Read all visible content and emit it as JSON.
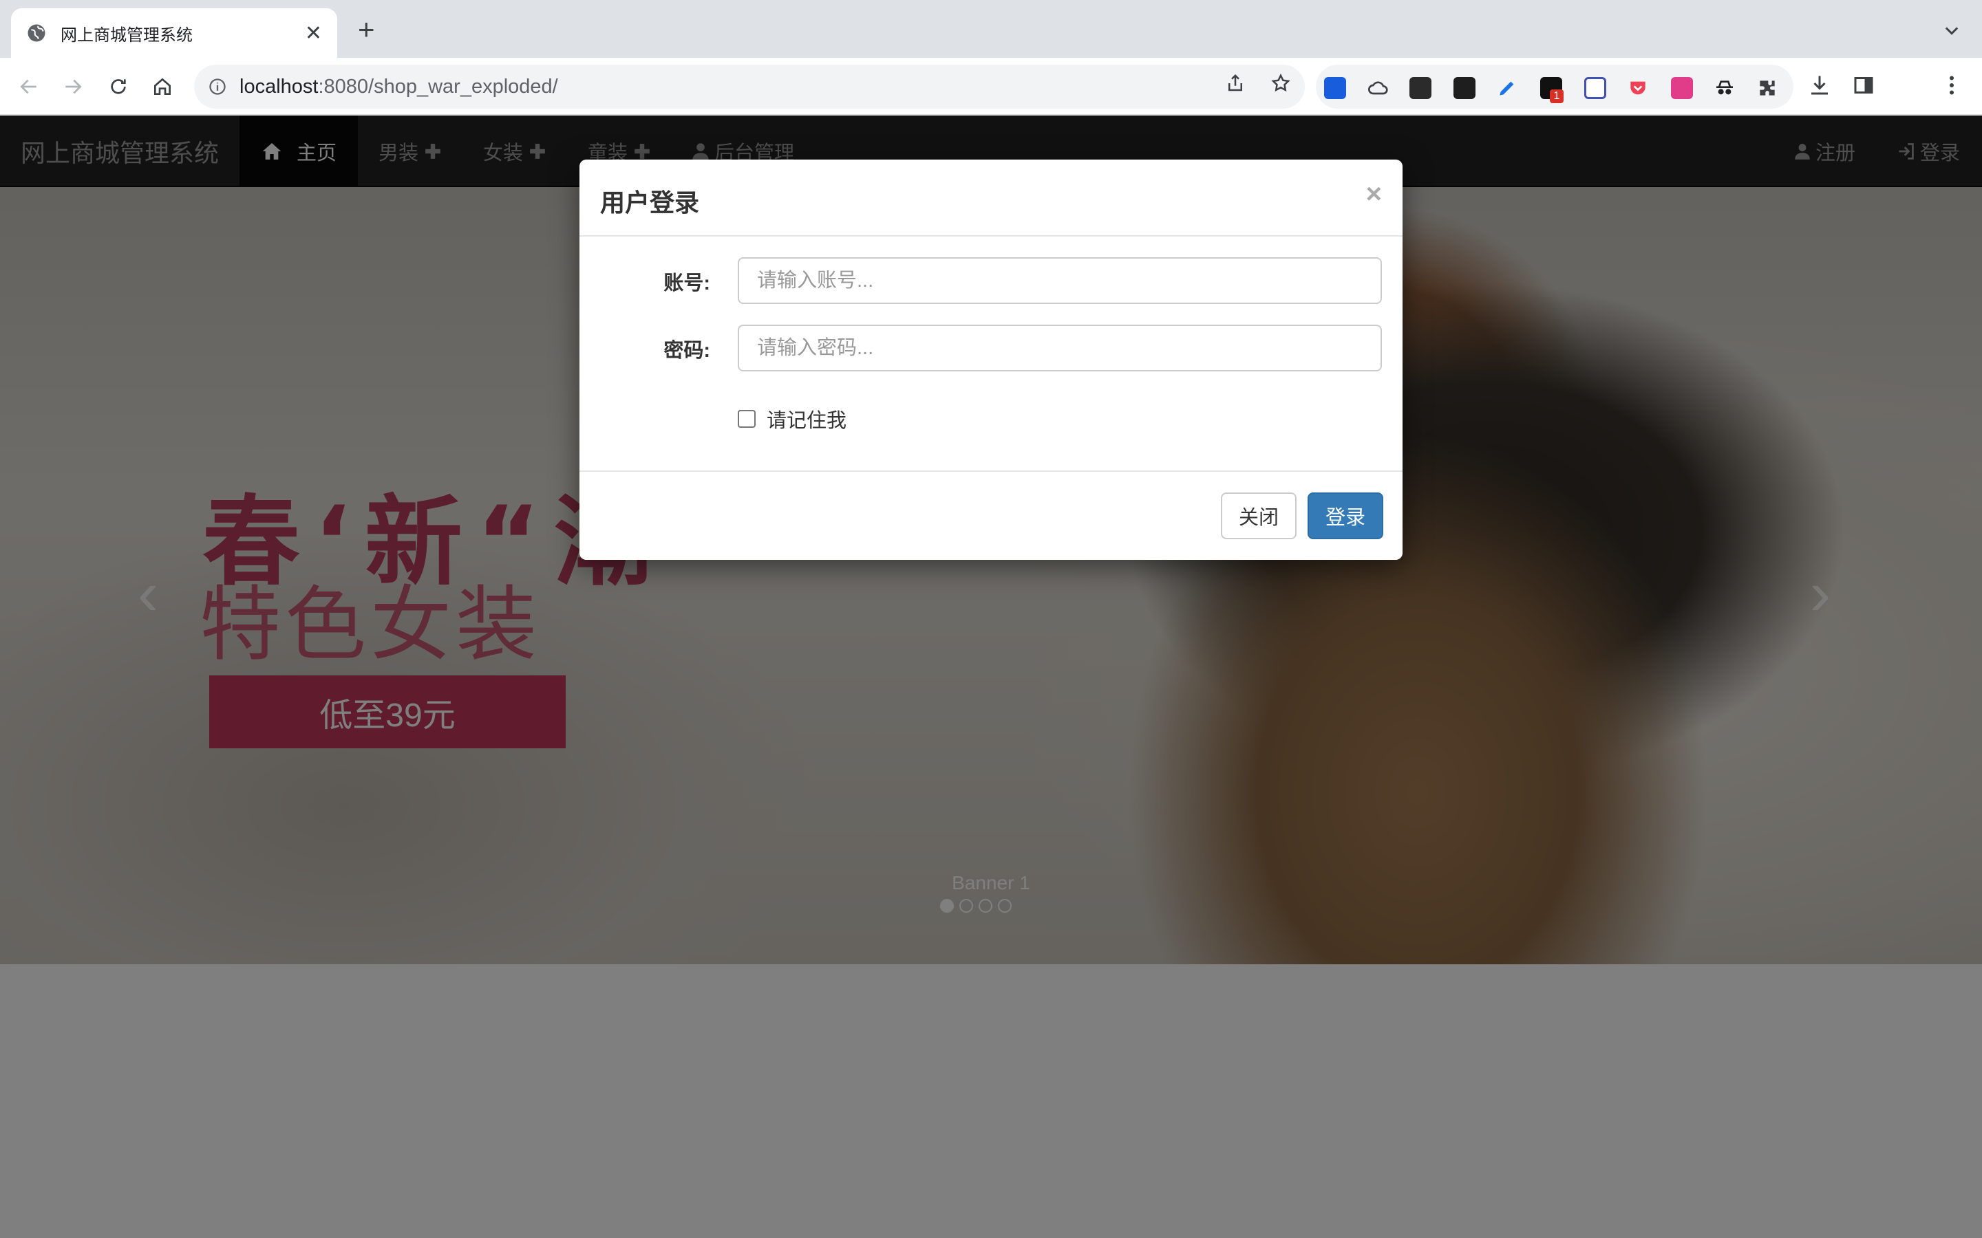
{
  "browser": {
    "tab_title": "网上商城管理系统",
    "url_host": "localhost",
    "url_rest": ":8080/shop_war_exploded/",
    "extension_badge": "1"
  },
  "navbar": {
    "brand": "网上商城管理系统",
    "items": [
      {
        "label": "主页",
        "icon": "home-icon"
      },
      {
        "label": "男装",
        "icon": "plus-icon"
      },
      {
        "label": "女装",
        "icon": "plus-icon"
      },
      {
        "label": "童装",
        "icon": "plus-icon"
      },
      {
        "label": "后台管理",
        "icon": "user-icon"
      }
    ],
    "register": "注册",
    "login": "登录"
  },
  "carousel": {
    "headline": "春‘新“潮",
    "subheadline": "特色女装",
    "price_tag": "低至39元",
    "caption": "Banner 1",
    "slide_count": 4,
    "active_slide": 1
  },
  "modal": {
    "title": "用户登录",
    "account_label": "账号:",
    "account_placeholder": "请输入账号...",
    "password_label": "密码:",
    "password_placeholder": "请输入密码...",
    "remember_label": "请记住我",
    "close_button": "关闭",
    "login_button": "登录"
  },
  "colors": {
    "primary": "#337ab7",
    "navbar_bg": "#222222",
    "banner_accent": "#c0365a"
  }
}
